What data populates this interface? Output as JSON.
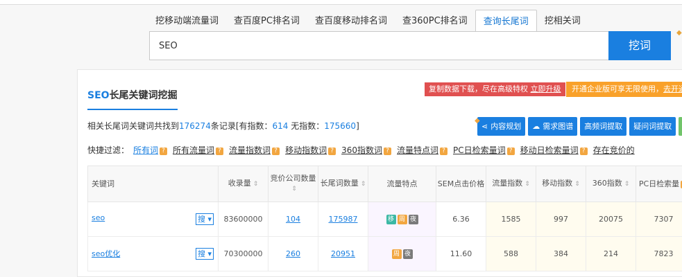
{
  "tabs": [
    "挖移动端流量词",
    "查百度PC排名词",
    "查百度移动排名词",
    "查360PC排名词",
    "查询长尾词",
    "挖相关词"
  ],
  "active_tab_index": 4,
  "search": {
    "value": "SEO",
    "button": "挖词"
  },
  "panel": {
    "title_prefix": "SEO",
    "title_rest": "长尾关键词挖掘",
    "notice_red": {
      "text": "复制数据下载，尽在高级特权 ",
      "link": "立即升级"
    },
    "notice_orange": {
      "text": "开通企业版可享无限使用，",
      "link": "去开通"
    },
    "summary": {
      "prefix": "相关长尾词关键词共找到",
      "total": "176274",
      "mid": "条记录[有指数：",
      "with_index": "614",
      "mid2": " 无指数：",
      "without_index": "175660",
      "suffix": "]"
    },
    "actions": [
      "内容规划",
      "需求图谱",
      "高频词提取",
      "疑问词提取"
    ],
    "filters": {
      "label": "快捷过滤：",
      "items": [
        "所有词",
        "所有流量词",
        "流量指数词",
        "移动指数词",
        "360指数词",
        "流量特点词",
        "PC日检索量词",
        "移动日检索量词",
        "存在竞价的"
      ]
    },
    "table": {
      "headers": [
        "关键词",
        "收录量",
        "竞价公司数量",
        "长尾词数量",
        "流量特点",
        "SEM点击价格",
        "流量指数",
        "移动指数",
        "360指数",
        "PC日检索量"
      ],
      "rows": [
        {
          "keyword": "seo",
          "search_btn": "搜",
          "indexed": "83600000",
          "bid": "104",
          "longtail": "175987",
          "tags": [
            "移",
            "周",
            "夜"
          ],
          "sem": "6.36",
          "flow": "1585",
          "mobile": "997",
          "i360": "20075",
          "pc": "7307"
        },
        {
          "keyword": "seo优化",
          "search_btn": "搜",
          "indexed": "70300000",
          "bid": "260",
          "longtail": "20951",
          "tags": [
            "周",
            "夜"
          ],
          "sem": "11.60",
          "flow": "588",
          "mobile": "384",
          "i360": "214",
          "pc": "7823"
        }
      ]
    }
  },
  "colors": {
    "accent": "#1a7fe0",
    "red": "#e05050",
    "orange": "#f9a12a"
  }
}
